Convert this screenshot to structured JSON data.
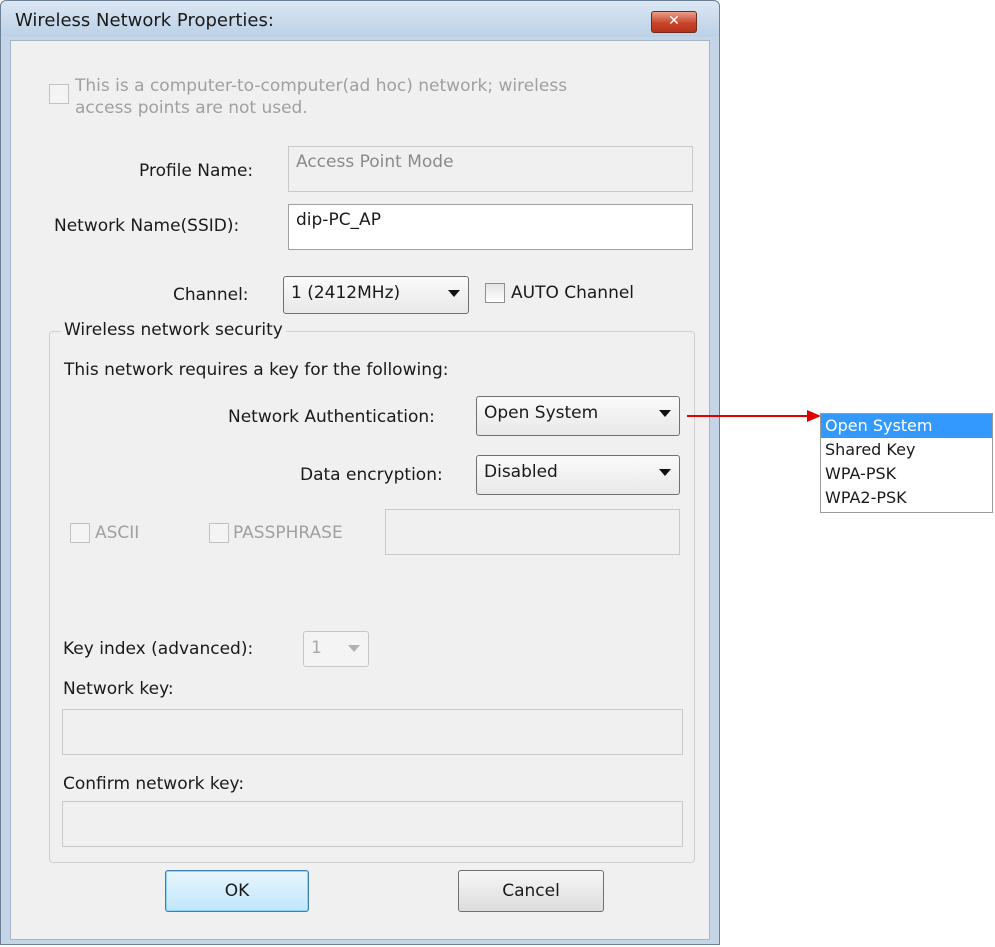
{
  "dialog": {
    "title": "Wireless Network Properties:",
    "close_glyph": "✕",
    "adhoc_label_line1": "This is a computer-to-computer(ad hoc) network; wireless",
    "adhoc_label_line2": "access points are not used.",
    "adhoc_checked": false,
    "profile_name_label": "Profile Name:",
    "profile_name_value": "Access Point Mode",
    "ssid_label": "Network Name(SSID):",
    "ssid_value": "dip-PC_AP",
    "channel_label": "Channel:",
    "channel_value": "1  (2412MHz)",
    "auto_channel_label": "AUTO Channel",
    "auto_channel_checked": false
  },
  "security": {
    "group_label": "Wireless network security",
    "intro_text": "This network requires a key for the following:",
    "auth_label": "Network Authentication:",
    "auth_value": "Open System",
    "encryption_label": "Data encryption:",
    "encryption_value": "Disabled",
    "ascii_label": "ASCII",
    "passphrase_label": "PASSPHRASE",
    "passphrase_value": "",
    "key_index_label": "Key index (advanced):",
    "key_index_value": "1",
    "network_key_label": "Network key:",
    "network_key_value": "",
    "confirm_key_label": "Confirm network key:",
    "confirm_key_value": ""
  },
  "buttons": {
    "ok_label": "OK",
    "cancel_label": "Cancel"
  },
  "auth_dropdown": {
    "selected": "Open System",
    "options": [
      "Open System",
      "Shared Key",
      "WPA-PSK",
      "WPA2-PSK"
    ]
  },
  "colors": {
    "arrow": "#e00000",
    "selection": "#3399ff"
  }
}
